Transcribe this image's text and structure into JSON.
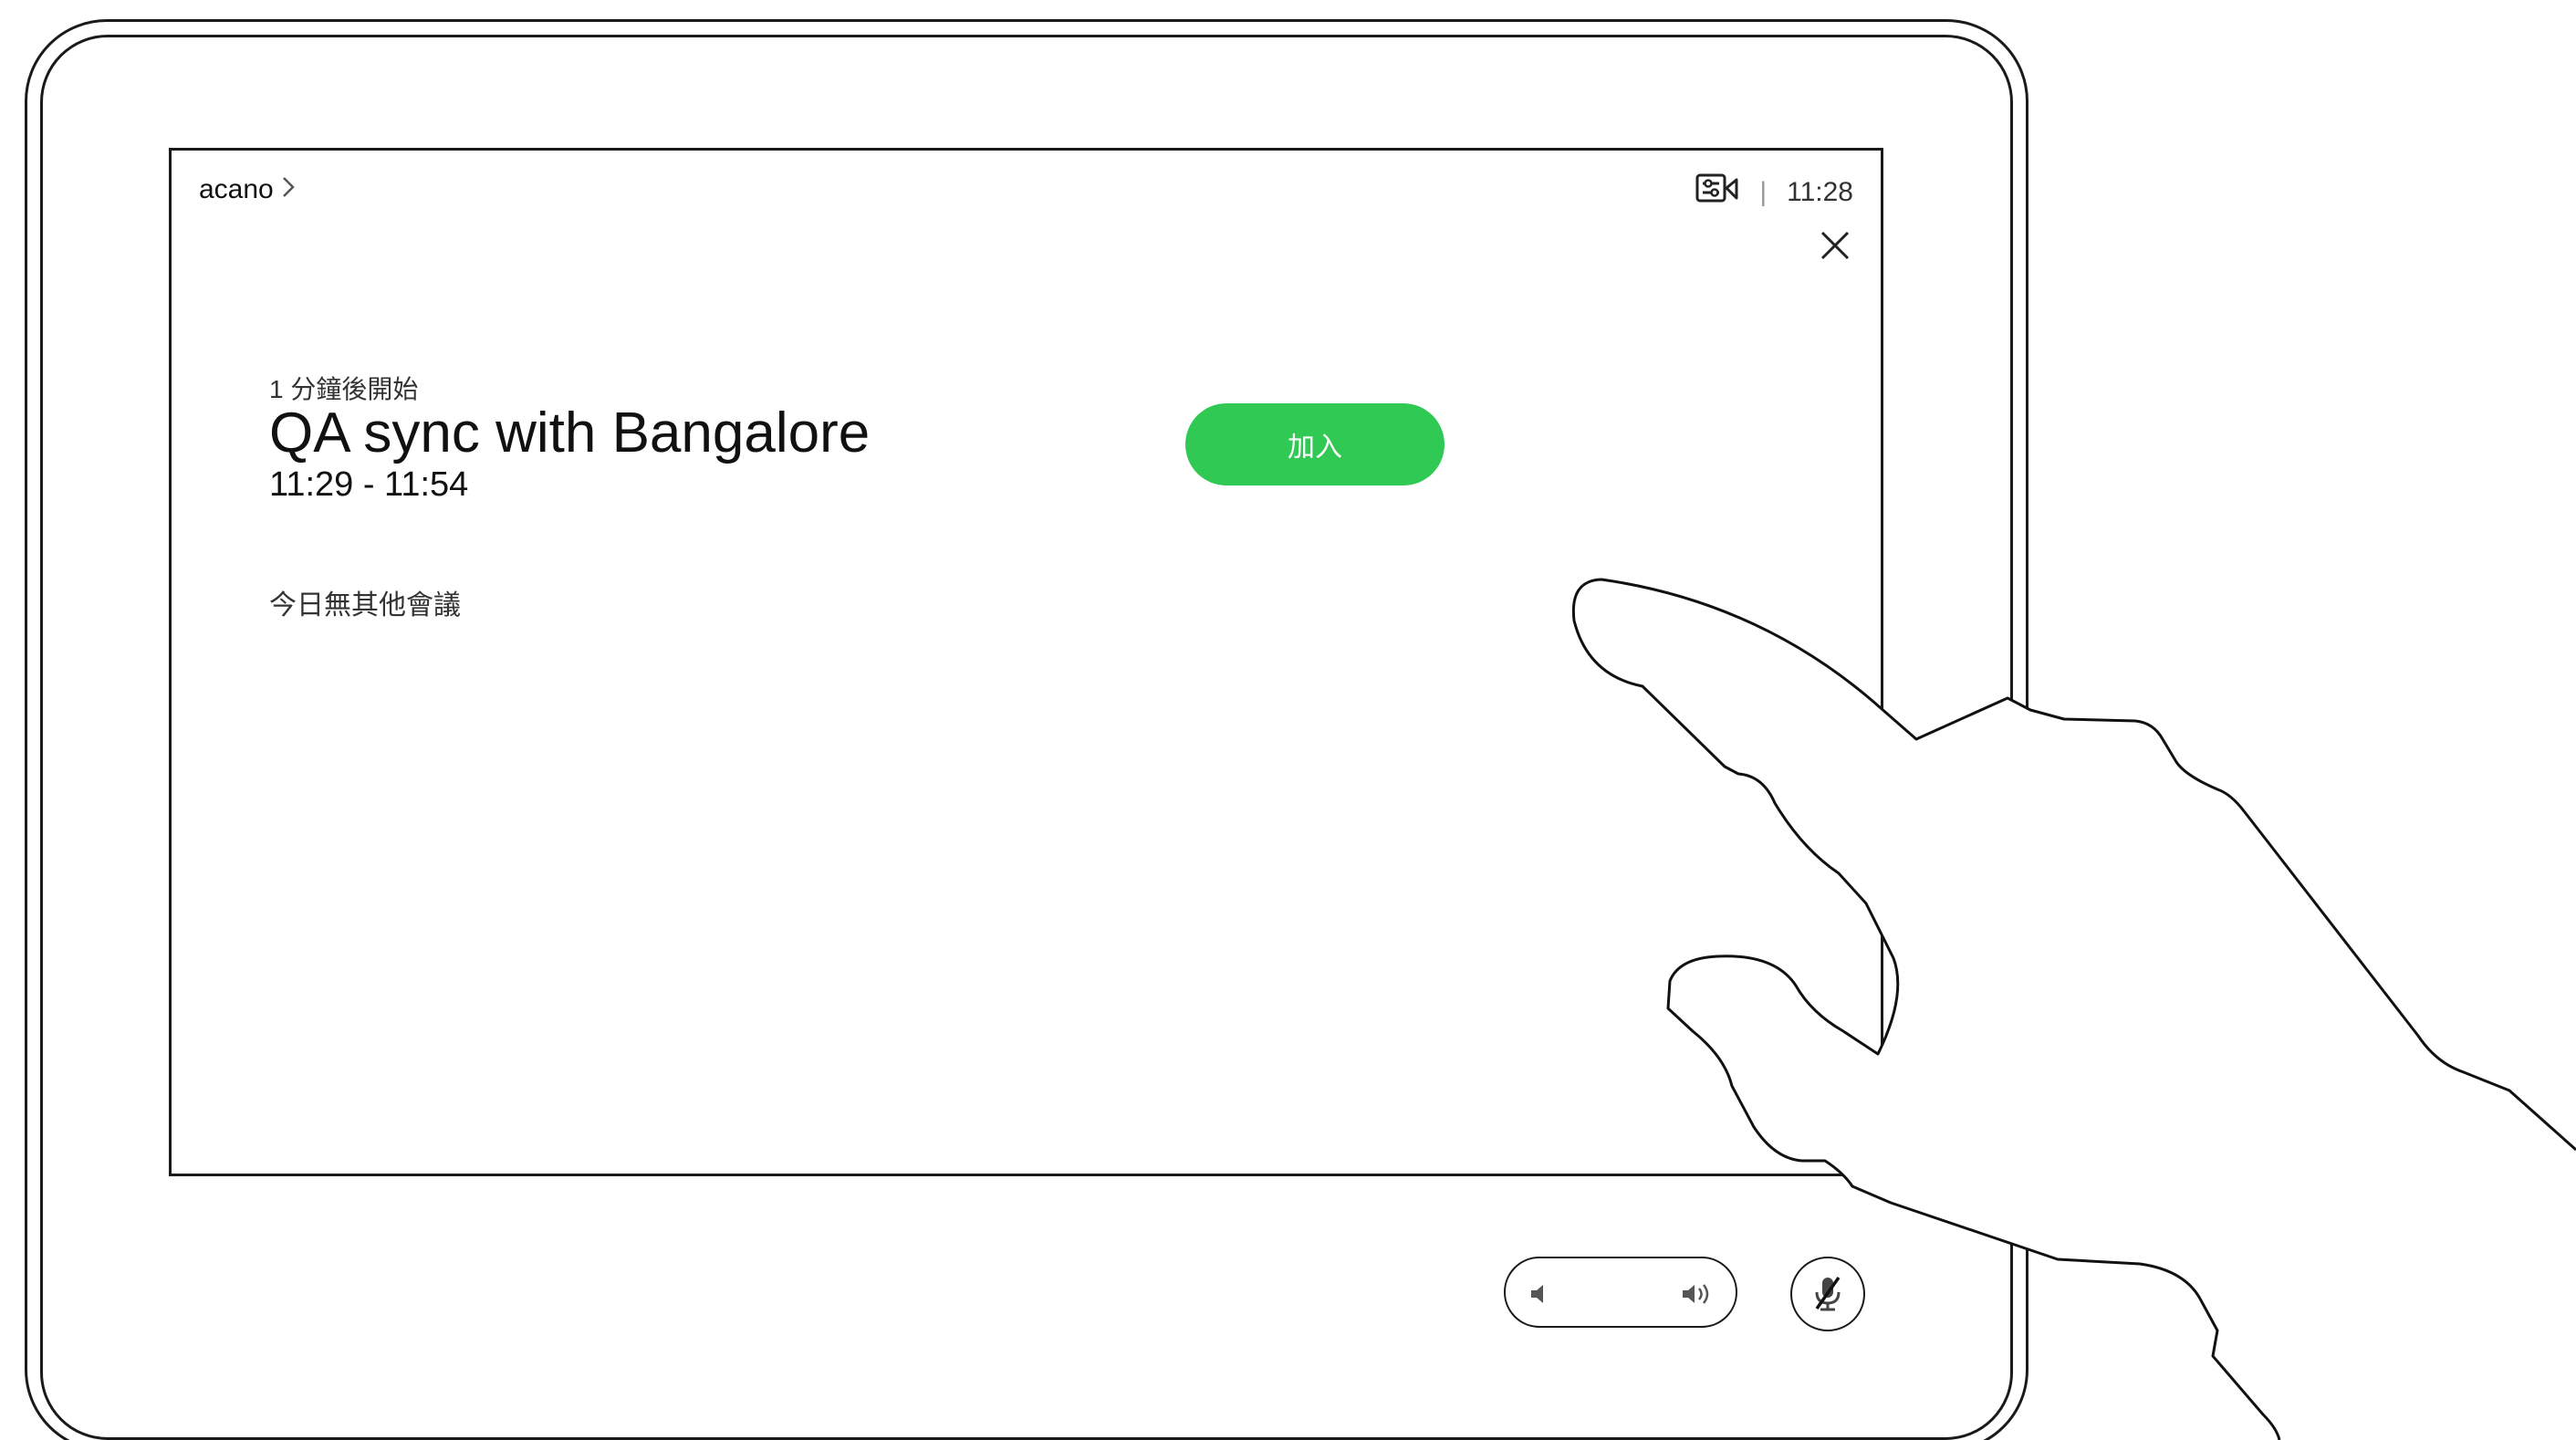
{
  "header": {
    "breadcrumb_label": "acano",
    "clock": "11:28"
  },
  "meeting": {
    "status": "1 分鐘後開始",
    "title": "QA sync with Bangalore",
    "time_range": "11:29 - 11:54"
  },
  "no_more_meetings": "今日無其他會議",
  "join_button_label": "加入",
  "colors": {
    "join_button": "#2fc954",
    "outline": "#1a1a1a"
  },
  "icons": {
    "camera_settings": "camera-settings-icon",
    "close": "close-icon",
    "volume_down": "volume-down-icon",
    "volume_up": "volume-up-icon",
    "microphone_muted": "microphone-muted-icon",
    "chevron": "chevron-right-icon"
  }
}
